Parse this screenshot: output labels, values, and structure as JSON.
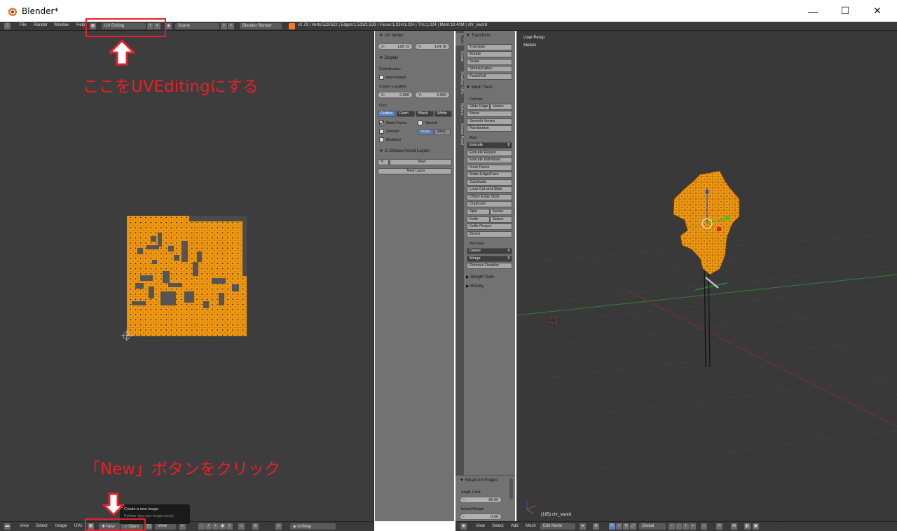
{
  "window": {
    "title": "Blender*",
    "controls": {
      "minimize": "—",
      "maximize": "☐",
      "close": "✕"
    }
  },
  "infobar": {
    "menus": [
      "File",
      "Render",
      "Window",
      "Help"
    ],
    "screen_layout": "UV Editing",
    "scene": "Scene",
    "render_engine": "Blender Render",
    "stats": "v2.78 | Verts:522/522 | Edges:1,533/1,533 | Faces:1,024/1,024 | Tris:1,024 | Mem:19.40M | chr_sword"
  },
  "annotations": {
    "top_note": "ここをUVEditingにする",
    "bottom_note": "「New」ボタンをクリック"
  },
  "n_panel": {
    "uv_vertex_header": "UV Vertex",
    "uv_x_label": "X:",
    "uv_x_value": "128.72",
    "uv_y_label": "Y:",
    "uv_y_value": "124.78",
    "display_header": "Display",
    "coordinates_label": "Coordinates:",
    "normalized_label": "Normalized",
    "cursor_location_label": "Cursor Location:",
    "cursor_x_label": "X:",
    "cursor_x_value": "0.000",
    "cursor_y_label": "Y:",
    "cursor_y_value": "0.000",
    "uvs_label": "UVs:",
    "uv_modes": [
      "Outline",
      "Dash",
      "Black",
      "White"
    ],
    "draw_faces_label": "Draw Faces",
    "stretch_label": "Stretch",
    "smooth_label": "Smooth",
    "angle_label": "Angle",
    "area_label": "Area",
    "modified_label": "Modified",
    "grease_pencil_header": "Grease Pencil Layers",
    "new_label": "New",
    "new_layer_label": "New Layer"
  },
  "tool_tabs": [
    "Tools",
    "Create",
    "Shading / UVs",
    "Options",
    "Grease Pencil"
  ],
  "t_panel": {
    "transform_header": "Transform",
    "transform_buttons": [
      "Translate",
      "Rotate",
      "Scale",
      "Shrink/Fatten",
      "Push/Pull"
    ],
    "mesh_tools_header": "Mesh Tools",
    "deform_label": "Deform:",
    "slide_edge": "Slide Edge",
    "vertex": "Vertex",
    "deform_buttons": [
      "Noise",
      "Smooth Vertex",
      "Randomize"
    ],
    "add_label": "Add:",
    "extrude": "Extrude",
    "add_buttons": [
      "Extrude Region",
      "Extrude Individual",
      "Inset Faces",
      "Make Edge/Face",
      "Subdivide",
      "Loop Cut and Slide",
      "Offset Edge Slide",
      "Duplicate"
    ],
    "spin": "Spin",
    "screw": "Screw",
    "knife": "Knife",
    "select": "Select",
    "knife_project": "Knife Project",
    "bisect": "Bisect",
    "remove_label": "Remove:",
    "delete": "Delete",
    "merge": "Merge",
    "remove_doubles": "Remove Doubles",
    "weight_tools_header": "Weight Tools",
    "history_header": "History"
  },
  "smart_uv": {
    "header": "Smart UV Project",
    "angle_limit_label": "Angle Limit:",
    "angle_limit_value": "66.00",
    "island_margin_label": "Island Margin",
    "island_margin_value": "0.00"
  },
  "viewport": {
    "view_name": "User Persp",
    "units": "Meters",
    "object_info": "(185) chr_sword"
  },
  "uv_bottom_bar": {
    "menus": [
      "View",
      "Select",
      "Image",
      "UVs"
    ],
    "new_button": "New",
    "open_button": "Open",
    "view_label": "View",
    "uvmap": "UVMap"
  },
  "tooltip": {
    "title": "Create a new image",
    "python": "Python: bpy.ops.image.new()"
  },
  "view3d_bottom_bar": {
    "menus": [
      "View",
      "Select",
      "Add",
      "Mesh"
    ],
    "mode": "Edit Mode",
    "pivot": "Global"
  },
  "colors": {
    "annotation_red": "#e8202a",
    "mesh_orange": "#f39a12",
    "selection_blue": "#5680c2"
  }
}
